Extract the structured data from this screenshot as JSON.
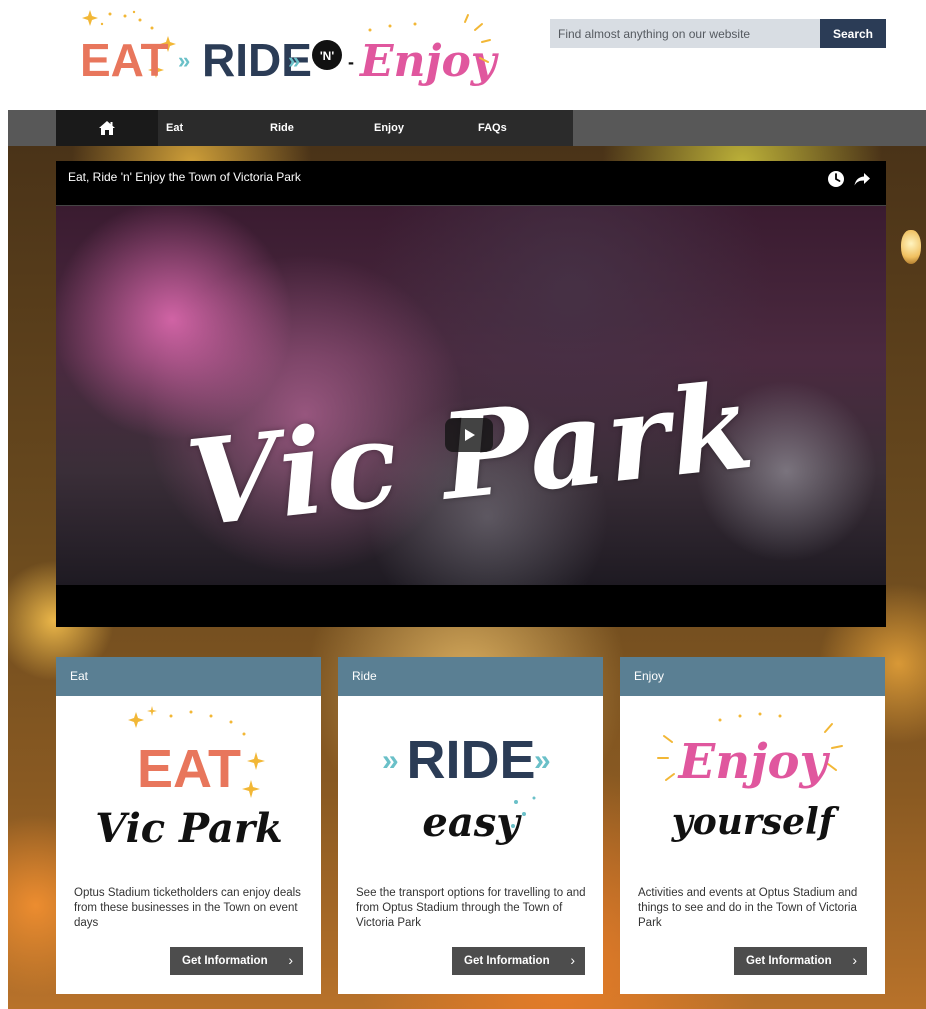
{
  "colors": {
    "search_button": "#2b3c56",
    "card_header": "#5a7f93",
    "nav_bar": "#585858",
    "nav_inner": "#2b2b2b",
    "card_button": "#4d4d4d",
    "logo_eat": "#e8765c",
    "logo_ride": "#2b3c56",
    "logo_ride_arrows": "#6ac0c8",
    "logo_enjoy": "#e0579e",
    "logo_sparkle": "#f2b736"
  },
  "header": {
    "logo": {
      "eat": "EAT",
      "ride": "RIDE",
      "n": "'N'",
      "enjoy": "Enjoy"
    },
    "search": {
      "placeholder": "Find almost anything on our website",
      "button_label": "Search"
    }
  },
  "nav": {
    "home_icon": "home-icon",
    "items": [
      {
        "label": "Eat"
      },
      {
        "label": "Ride"
      },
      {
        "label": "Enjoy"
      },
      {
        "label": "FAQs"
      }
    ]
  },
  "video": {
    "title": "Eat, Ride 'n' Enjoy the Town of Victoria Park",
    "watermark": "Vic Park",
    "icons": [
      "clock-icon",
      "share-icon",
      "play-icon"
    ]
  },
  "cards": [
    {
      "header": "Eat",
      "logo_line1": "EAT",
      "logo_line2": "Vic Park",
      "description": "Optus Stadium ticketholders can enjoy deals from these businesses in the Town on event days",
      "button_label": "Get Information"
    },
    {
      "header": "Ride",
      "logo_line1": "RIDE",
      "logo_line2": "easy",
      "description": "See the transport options for travelling to and from Optus Stadium through the Town of Victoria Park",
      "button_label": "Get Information"
    },
    {
      "header": "Enjoy",
      "logo_line1": "Enjoy",
      "logo_line2": "yourself",
      "description": "Activities and events at Optus Stadium and things to see and do in the Town of Victoria Park",
      "button_label": "Get Information"
    }
  ]
}
